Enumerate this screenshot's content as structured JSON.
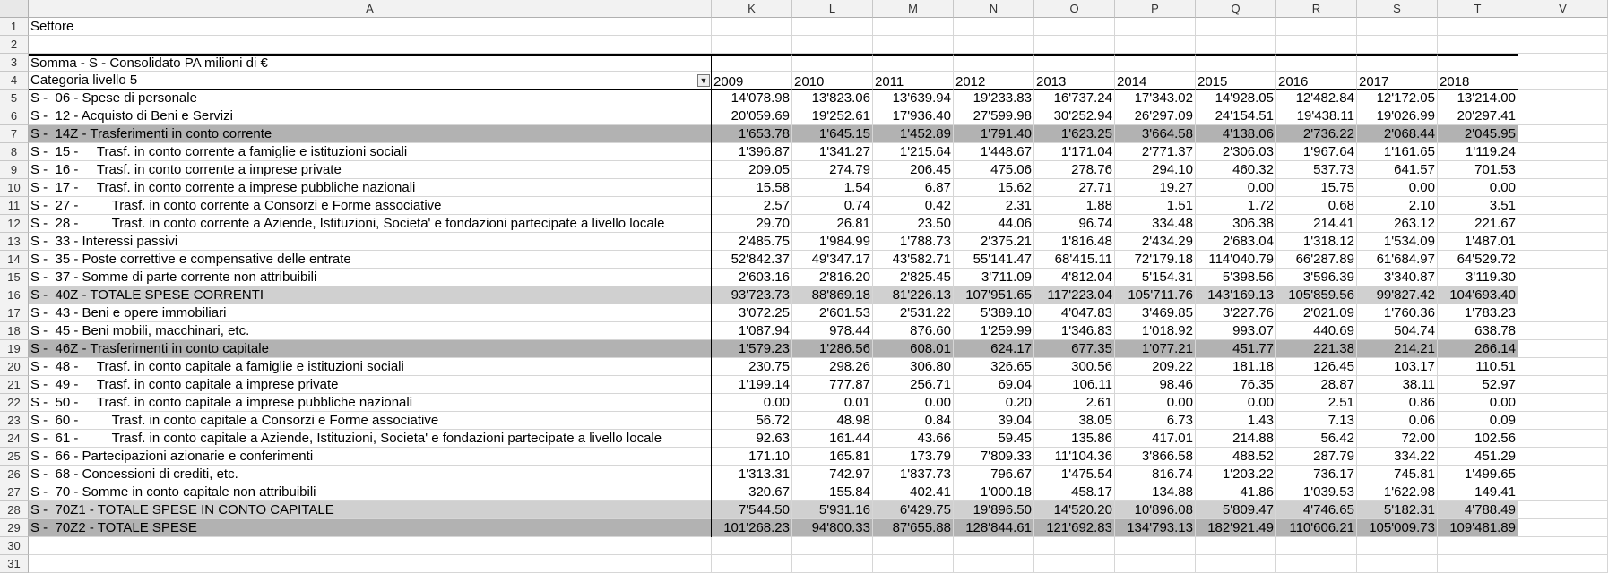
{
  "columns": [
    "A",
    "K",
    "L",
    "M",
    "N",
    "O",
    "P",
    "Q",
    "R",
    "S",
    "T",
    "V"
  ],
  "row_numbers": [
    "1",
    "2",
    "3",
    "4",
    "5",
    "6",
    "7",
    "8",
    "9",
    "10",
    "11",
    "12",
    "13",
    "14",
    "15",
    "16",
    "17",
    "18",
    "19",
    "20",
    "21",
    "22",
    "23",
    "24",
    "25",
    "26",
    "27",
    "28",
    "29",
    "30",
    "31"
  ],
  "header": {
    "settore": "Settore",
    "title": "Somma - S - Consolidato PA milioni di €",
    "categoria": "Categoria livello 5",
    "years": [
      "2009",
      "2010",
      "2011",
      "2012",
      "2013",
      "2014",
      "2015",
      "2016",
      "2017",
      "2018"
    ]
  },
  "filter_icon": "chevron-down-icon",
  "rows": [
    {
      "label": "S -  06 - Spese di personale",
      "style": "",
      "values": [
        "14'078.98",
        "13'823.06",
        "13'639.94",
        "19'233.83",
        "16'737.24",
        "17'343.02",
        "14'928.05",
        "12'482.84",
        "12'172.05",
        "13'214.00"
      ]
    },
    {
      "label": "S -  12 - Acquisto di Beni e Servizi",
      "style": "",
      "values": [
        "20'059.69",
        "19'252.61",
        "17'936.40",
        "27'599.98",
        "30'252.94",
        "26'297.09",
        "24'154.51",
        "19'438.11",
        "19'026.99",
        "20'297.41"
      ]
    },
    {
      "label": "S -  14Z - Trasferimenti in conto corrente",
      "style": "dark",
      "values": [
        "1'653.78",
        "1'645.15",
        "1'452.89",
        "1'791.40",
        "1'623.25",
        "3'664.58",
        "4'138.06",
        "2'736.22",
        "2'068.44",
        "2'045.95"
      ]
    },
    {
      "label": "S -  15 -     Trasf. in conto corrente a famiglie e istituzioni sociali",
      "style": "",
      "values": [
        "1'396.87",
        "1'341.27",
        "1'215.64",
        "1'448.67",
        "1'171.04",
        "2'771.37",
        "2'306.03",
        "1'967.64",
        "1'161.65",
        "1'119.24"
      ]
    },
    {
      "label": "S -  16 -     Trasf. in conto corrente a imprese private",
      "style": "",
      "values": [
        "209.05",
        "274.79",
        "206.45",
        "475.06",
        "278.76",
        "294.10",
        "460.32",
        "537.73",
        "641.57",
        "701.53"
      ]
    },
    {
      "label": "S -  17 -     Trasf. in conto corrente a imprese pubbliche nazionali",
      "style": "",
      "values": [
        "15.58",
        "1.54",
        "6.87",
        "15.62",
        "27.71",
        "19.27",
        "0.00",
        "15.75",
        "0.00",
        "0.00"
      ]
    },
    {
      "label": "S -  27 -         Trasf. in conto corrente a Consorzi e Forme associative",
      "style": "",
      "values": [
        "2.57",
        "0.74",
        "0.42",
        "2.31",
        "1.88",
        "1.51",
        "1.72",
        "0.68",
        "2.10",
        "3.51"
      ]
    },
    {
      "label": "S -  28 -         Trasf. in conto corrente a Aziende, Istituzioni, Societa' e fondazioni partecipate a livello locale",
      "style": "",
      "values": [
        "29.70",
        "26.81",
        "23.50",
        "44.06",
        "96.74",
        "334.48",
        "306.38",
        "214.41",
        "263.12",
        "221.67"
      ]
    },
    {
      "label": "S -  33 - Interessi passivi",
      "style": "",
      "values": [
        "2'485.75",
        "1'984.99",
        "1'788.73",
        "2'375.21",
        "1'816.48",
        "2'434.29",
        "2'683.04",
        "1'318.12",
        "1'534.09",
        "1'487.01"
      ]
    },
    {
      "label": "S -  35 - Poste correttive e compensative delle entrate",
      "style": "",
      "values": [
        "52'842.37",
        "49'347.17",
        "43'582.71",
        "55'141.47",
        "68'415.11",
        "72'179.18",
        "114'040.79",
        "66'287.89",
        "61'684.97",
        "64'529.72"
      ]
    },
    {
      "label": "S -  37 - Somme di parte corrente non attribuibili",
      "style": "",
      "values": [
        "2'603.16",
        "2'816.20",
        "2'825.45",
        "3'711.09",
        "4'812.04",
        "5'154.31",
        "5'398.56",
        "3'596.39",
        "3'340.87",
        "3'119.30"
      ]
    },
    {
      "label": "S -  40Z - TOTALE SPESE CORRENTI",
      "style": "light",
      "values": [
        "93'723.73",
        "88'869.18",
        "81'226.13",
        "107'951.65",
        "117'223.04",
        "105'711.76",
        "143'169.13",
        "105'859.56",
        "99'827.42",
        "104'693.40"
      ]
    },
    {
      "label": "S -  43 - Beni e opere immobiliari",
      "style": "",
      "values": [
        "3'072.25",
        "2'601.53",
        "2'531.22",
        "5'389.10",
        "4'047.83",
        "3'469.85",
        "3'227.76",
        "2'021.09",
        "1'760.36",
        "1'783.23"
      ]
    },
    {
      "label": "S -  45 - Beni mobili, macchinari, etc.",
      "style": "",
      "values": [
        "1'087.94",
        "978.44",
        "876.60",
        "1'259.99",
        "1'346.83",
        "1'018.92",
        "993.07",
        "440.69",
        "504.74",
        "638.78"
      ]
    },
    {
      "label": "S -  46Z - Trasferimenti in conto capitale",
      "style": "dark",
      "values": [
        "1'579.23",
        "1'286.56",
        "608.01",
        "624.17",
        "677.35",
        "1'077.21",
        "451.77",
        "221.38",
        "214.21",
        "266.14"
      ]
    },
    {
      "label": "S -  48 -     Trasf. in conto capitale a famiglie e istituzioni sociali",
      "style": "",
      "values": [
        "230.75",
        "298.26",
        "306.80",
        "326.65",
        "300.56",
        "209.22",
        "181.18",
        "126.45",
        "103.17",
        "110.51"
      ]
    },
    {
      "label": "S -  49 -     Trasf. in conto capitale a imprese private",
      "style": "",
      "values": [
        "1'199.14",
        "777.87",
        "256.71",
        "69.04",
        "106.11",
        "98.46",
        "76.35",
        "28.87",
        "38.11",
        "52.97"
      ]
    },
    {
      "label": "S -  50 -     Trasf. in conto capitale a imprese pubbliche nazionali",
      "style": "",
      "values": [
        "0.00",
        "0.01",
        "0.00",
        "0.20",
        "2.61",
        "0.00",
        "0.00",
        "2.51",
        "0.86",
        "0.00"
      ]
    },
    {
      "label": "S -  60 -         Trasf. in conto capitale a Consorzi e Forme associative",
      "style": "",
      "values": [
        "56.72",
        "48.98",
        "0.84",
        "39.04",
        "38.05",
        "6.73",
        "1.43",
        "7.13",
        "0.06",
        "0.09"
      ]
    },
    {
      "label": "S -  61 -         Trasf. in conto capitale a Aziende, Istituzioni, Societa' e fondazioni partecipate a livello locale",
      "style": "",
      "values": [
        "92.63",
        "161.44",
        "43.66",
        "59.45",
        "135.86",
        "417.01",
        "214.88",
        "56.42",
        "72.00",
        "102.56"
      ]
    },
    {
      "label": "S -  66 - Partecipazioni azionarie e conferimenti",
      "style": "",
      "values": [
        "171.10",
        "165.81",
        "173.79",
        "7'809.33",
        "11'104.36",
        "3'866.58",
        "488.52",
        "287.79",
        "334.22",
        "451.29"
      ]
    },
    {
      "label": "S -  68 - Concessioni di crediti, etc.",
      "style": "",
      "values": [
        "1'313.31",
        "742.97",
        "1'837.73",
        "796.67",
        "1'475.54",
        "816.74",
        "1'203.22",
        "736.17",
        "745.81",
        "1'499.65"
      ]
    },
    {
      "label": "S -  70 - Somme in conto capitale non attribuibili",
      "style": "",
      "values": [
        "320.67",
        "155.84",
        "402.41",
        "1'000.18",
        "458.17",
        "134.88",
        "41.86",
        "1'039.53",
        "1'622.98",
        "149.41"
      ]
    },
    {
      "label": "S -  70Z1 - TOTALE SPESE IN CONTO CAPITALE",
      "style": "light",
      "values": [
        "7'544.50",
        "5'931.16",
        "6'429.75",
        "19'896.50",
        "14'520.20",
        "10'896.08",
        "5'809.47",
        "4'746.65",
        "5'182.31",
        "4'788.49"
      ]
    },
    {
      "label": "S -  70Z2 - TOTALE SPESE",
      "style": "dark",
      "values": [
        "101'268.23",
        "94'800.33",
        "87'655.88",
        "128'844.61",
        "121'692.83",
        "134'793.13",
        "182'921.49",
        "110'606.21",
        "105'009.73",
        "109'481.89"
      ]
    }
  ]
}
